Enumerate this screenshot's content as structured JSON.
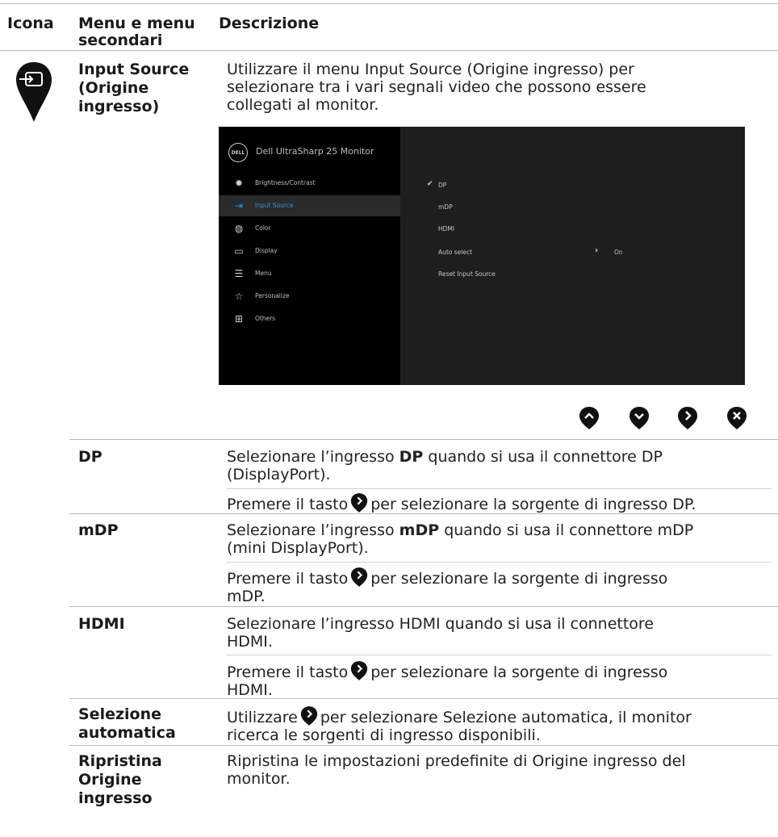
{
  "header": {
    "icon_col": "Icona",
    "menu_col_line1": "Menu e menu",
    "menu_col_line2": "secondari",
    "desc_col": "Descrizione"
  },
  "input_source": {
    "name_line1": "Input Source",
    "name_line2": "(Origine",
    "name_line3": "ingresso)",
    "desc_line1": "Utilizzare il menu Input Source (Origine ingresso) per",
    "desc_line2": "selezionare tra i vari segnali video che possono essere",
    "desc_line3": "collegati al monitor.",
    "icon": "input-source-icon"
  },
  "osd": {
    "logo": "DELL",
    "title": "Dell UltraSharp 25 Monitor",
    "menu": [
      {
        "label": "Brightness/Contrast",
        "icon": "sun-icon"
      },
      {
        "label": "Input Source",
        "icon": "input-icon"
      },
      {
        "label": "Color",
        "icon": "palette-icon"
      },
      {
        "label": "Display",
        "icon": "display-icon"
      },
      {
        "label": "Menu",
        "icon": "menu-icon"
      },
      {
        "label": "Personalize",
        "icon": "star-icon"
      },
      {
        "label": "Others",
        "icon": "others-icon"
      }
    ],
    "options": [
      "DP",
      "mDP",
      "HDMI",
      "Auto select",
      "Reset Input Source"
    ],
    "selected_option": "DP",
    "auto_select_value": "On",
    "accent": "#3c8fd6"
  },
  "nav_buttons": [
    "up-icon",
    "down-icon",
    "right-icon",
    "close-icon"
  ],
  "rows": {
    "dp": {
      "name": "DP",
      "d1_pre": "Selezionare l’ingresso ",
      "d1_bold": "DP",
      "d1_post": " quando si usa il connettore DP",
      "d2": "(DisplayPort).",
      "d3_pre": "Premere il tasto",
      "d3_post": "per selezionare la sorgente di ingresso DP."
    },
    "mdp": {
      "name": "mDP",
      "d1_pre": "Selezionare l’ingresso ",
      "d1_bold": "mDP",
      "d1_post": " quando si usa il connettore mDP",
      "d2": "(mini DisplayPort).",
      "d3_pre": "Premere il tasto",
      "d3_post": "per selezionare la sorgente di ingresso",
      "d4": "mDP."
    },
    "hdmi": {
      "name": "HDMI",
      "d1": "Selezionare l’ingresso HDMI quando si usa il connettore",
      "d2": "HDMI.",
      "d3_pre": "Premere il tasto",
      "d3_post": "per selezionare la sorgente di ingresso",
      "d4": "HDMI."
    },
    "auto": {
      "name_line1": "Selezione",
      "name_line2": "automatica",
      "d1_pre": "Utilizzare",
      "d1_post": "per selezionare Selezione automatica, il monitor",
      "d2": "ricerca le sorgenti di ingresso disponibili."
    },
    "reset": {
      "name_line1": "Ripristina",
      "name_line2": "Origine",
      "name_line3": "ingresso",
      "d1": "Ripristina le impostazioni predefinite di Origine ingresso del",
      "d2": "monitor."
    }
  }
}
